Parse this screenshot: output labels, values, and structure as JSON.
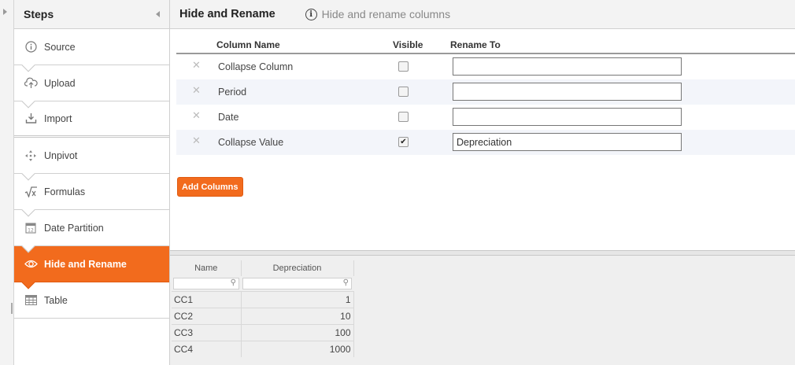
{
  "steps": {
    "title": "Steps",
    "items": [
      {
        "label": "Source",
        "icon": "info-circle-icon"
      },
      {
        "label": "Upload",
        "icon": "cloud-upload-icon"
      },
      {
        "label": "Import",
        "icon": "download-tray-icon"
      },
      {
        "label": "Unpivot",
        "icon": "unpivot-arrows-icon"
      },
      {
        "label": "Formulas",
        "icon": "square-root-icon"
      },
      {
        "label": "Date Partition",
        "icon": "calendar-icon"
      },
      {
        "label": "Hide and Rename",
        "icon": "eye-icon",
        "active": true
      },
      {
        "label": "Table",
        "icon": "table-grid-icon"
      }
    ]
  },
  "header": {
    "title": "Hide and Rename",
    "info_text": "Hide and rename columns"
  },
  "columns_grid": {
    "headers": {
      "column_name": "Column Name",
      "visible": "Visible",
      "rename_to": "Rename To"
    },
    "rows": [
      {
        "name": "Collapse Column",
        "visible": false,
        "rename": ""
      },
      {
        "name": "Period",
        "visible": false,
        "rename": ""
      },
      {
        "name": "Date",
        "visible": false,
        "rename": ""
      },
      {
        "name": "Collapse Value",
        "visible": true,
        "rename": "Depreciation"
      }
    ]
  },
  "add_columns_label": "Add Columns",
  "preview": {
    "columns": [
      "Name",
      "Depreciation"
    ],
    "rows": [
      [
        "CC1",
        "1"
      ],
      [
        "CC2",
        "10"
      ],
      [
        "CC3",
        "100"
      ],
      [
        "CC4",
        "1000"
      ]
    ]
  },
  "colors": {
    "accent": "#f26b1d",
    "row_alt": "#f3f5fa"
  }
}
